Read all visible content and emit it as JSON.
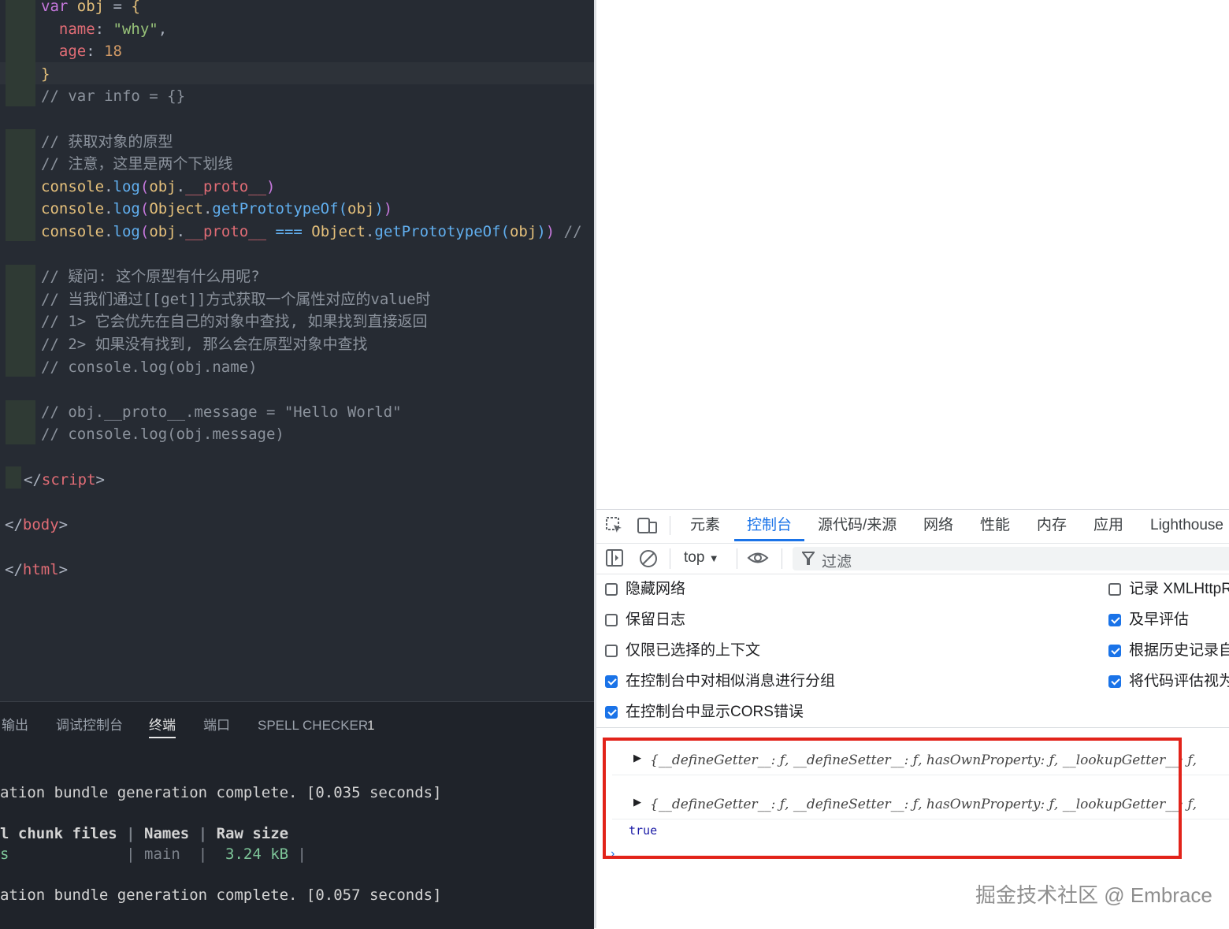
{
  "editor": {
    "lines": [
      {
        "segs": [
          [
            "kw",
            "var"
          ],
          [
            "punc",
            " "
          ],
          [
            "var",
            "obj"
          ],
          [
            "punc",
            " = "
          ],
          [
            "brace",
            "{"
          ]
        ]
      },
      {
        "segs": [
          [
            "punc",
            "  "
          ],
          [
            "prop",
            "name"
          ],
          [
            "punc",
            ": "
          ],
          [
            "str",
            "\"why\""
          ],
          [
            "punc",
            ","
          ]
        ]
      },
      {
        "segs": [
          [
            "punc",
            "  "
          ],
          [
            "prop",
            "age"
          ],
          [
            "punc",
            ": "
          ],
          [
            "num",
            "18"
          ]
        ]
      },
      {
        "segs": [
          [
            "brace",
            "}"
          ]
        ]
      },
      {
        "segs": [
          [
            "cm",
            "// var info = {}"
          ]
        ]
      },
      {
        "segs": []
      },
      {
        "segs": [
          [
            "cm",
            "// 获取对象的原型"
          ]
        ]
      },
      {
        "segs": [
          [
            "cm",
            "// 注意，这里是两个下划线"
          ]
        ]
      },
      {
        "segs": [
          [
            "var",
            "console"
          ],
          [
            "punc",
            "."
          ],
          [
            "fn",
            "log"
          ],
          [
            "paren",
            "("
          ],
          [
            "var",
            "obj"
          ],
          [
            "punc",
            "."
          ],
          [
            "prop",
            "__proto__"
          ],
          [
            "paren",
            ")"
          ]
        ]
      },
      {
        "segs": [
          [
            "var",
            "console"
          ],
          [
            "punc",
            "."
          ],
          [
            "fn",
            "log"
          ],
          [
            "paren",
            "("
          ],
          [
            "var",
            "Object"
          ],
          [
            "punc",
            "."
          ],
          [
            "fn",
            "getPrototypeOf"
          ],
          [
            "fn",
            "("
          ],
          [
            "var",
            "obj"
          ],
          [
            "fn",
            ")"
          ],
          [
            "paren",
            ")"
          ]
        ]
      },
      {
        "segs": [
          [
            "var",
            "console"
          ],
          [
            "punc",
            "."
          ],
          [
            "fn",
            "log"
          ],
          [
            "paren",
            "("
          ],
          [
            "var",
            "obj"
          ],
          [
            "punc",
            "."
          ],
          [
            "prop",
            "__proto__"
          ],
          [
            "punc",
            " "
          ],
          [
            "fn",
            "==="
          ],
          [
            "punc",
            " "
          ],
          [
            "var",
            "Object"
          ],
          [
            "punc",
            "."
          ],
          [
            "fn",
            "getPrototypeOf"
          ],
          [
            "fn",
            "("
          ],
          [
            "var",
            "obj"
          ],
          [
            "fn",
            ")"
          ],
          [
            "paren",
            ")"
          ],
          [
            "cm",
            " //"
          ]
        ]
      },
      {
        "segs": []
      },
      {
        "segs": [
          [
            "cm",
            "// 疑问: 这个原型有什么用呢?"
          ]
        ]
      },
      {
        "segs": [
          [
            "cm",
            "// 当我们通过[[get]]方式获取一个属性对应的value时"
          ]
        ]
      },
      {
        "segs": [
          [
            "cm",
            "// 1> 它会优先在自己的对象中查找, 如果找到直接返回"
          ]
        ]
      },
      {
        "segs": [
          [
            "cm",
            "// 2> 如果没有找到, 那么会在原型对象中查找"
          ]
        ]
      },
      {
        "segs": [
          [
            "cm",
            "// console.log(obj.name)"
          ]
        ]
      },
      {
        "segs": []
      },
      {
        "segs": [
          [
            "cm",
            "// obj.__proto__.message = \"Hello World\""
          ]
        ]
      },
      {
        "segs": [
          [
            "cm",
            "// console.log(obj.message)"
          ]
        ]
      },
      {
        "segs": []
      },
      {
        "segs": [
          [
            "punc",
            "</"
          ],
          [
            "tag",
            "script"
          ],
          [
            "punc",
            ">"
          ]
        ]
      },
      {
        "segs": []
      },
      {
        "segs": [
          [
            "punc",
            "</"
          ],
          [
            "tag",
            "body"
          ],
          [
            "punc",
            ">"
          ]
        ]
      },
      {
        "segs": []
      },
      {
        "segs": [
          [
            "punc",
            "</"
          ],
          [
            "tag",
            "html"
          ],
          [
            "punc",
            ">"
          ]
        ]
      }
    ]
  },
  "panel": {
    "tabs": [
      "输出",
      "调试控制台",
      "终端",
      "端口",
      "SPELL CHECKER"
    ],
    "active_tab": "终端",
    "spell_checker_count": "1",
    "terminal": {
      "line1": "ation bundle generation complete. [0.035 seconds]",
      "header_a": "l chunk files",
      "header_b": "Names",
      "header_c": "Raw size",
      "row_a": "s",
      "row_b": "main",
      "row_c": "3.24 kB",
      "line2": "ation bundle generation complete. [0.057 seconds]"
    }
  },
  "devtools": {
    "tabs": [
      "元素",
      "控制台",
      "源代码/来源",
      "网络",
      "性能",
      "内存",
      "应用",
      "Lighthouse"
    ],
    "active_tab": "控制台",
    "context": "top",
    "filter_placeholder": "过滤",
    "settings_left": [
      {
        "label": "隐藏网络",
        "checked": false
      },
      {
        "label": "保留日志",
        "checked": false
      },
      {
        "label": "仅限已选择的上下文",
        "checked": false
      },
      {
        "label": "在控制台中对相似消息进行分组",
        "checked": true
      },
      {
        "label": "在控制台中显示CORS错误",
        "checked": true
      }
    ],
    "settings_right": [
      {
        "label": "记录 XMLHttpR",
        "checked": false
      },
      {
        "label": "及早评估",
        "checked": true
      },
      {
        "label": "根据历史记录自",
        "checked": true
      },
      {
        "label": "将代码评估视为",
        "checked": true
      }
    ],
    "console_output": [
      "{__defineGetter__: ƒ, __defineSetter__: ƒ, hasOwnProperty: ƒ, __lookupGetter__: ƒ,",
      "{__defineGetter__: ƒ, __defineSetter__: ƒ, hasOwnProperty: ƒ, __lookupGetter__: ƒ,"
    ],
    "console_result": "true",
    "prompt": "›"
  },
  "watermark": "掘金技术社区 @ Embrace",
  "colors": {
    "accent": "#1a73e8",
    "highlight_box": "#e2231a",
    "editor_bg": "#262b33"
  }
}
